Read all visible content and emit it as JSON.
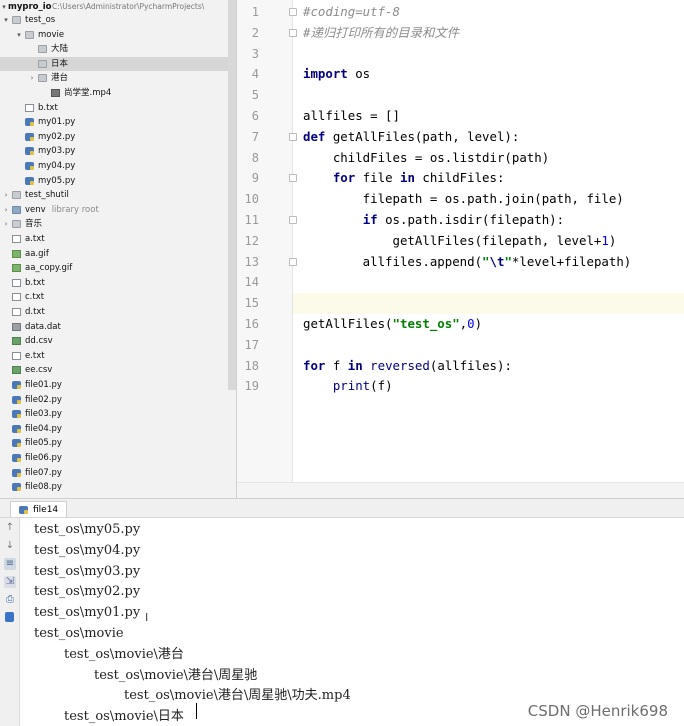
{
  "tree": {
    "root": {
      "label": "mypro_io",
      "path": "C:\\Users\\Administrator\\PycharmProjects\\"
    },
    "items": [
      {
        "label": "test_os",
        "kind": "folder",
        "indent": 0,
        "arrow": "▾"
      },
      {
        "label": "movie",
        "kind": "folder",
        "indent": 1,
        "arrow": "▾"
      },
      {
        "label": "大陆",
        "kind": "folder",
        "indent": 2,
        "arrow": ""
      },
      {
        "label": "日本",
        "kind": "folder",
        "indent": 2,
        "arrow": "",
        "selected": true
      },
      {
        "label": "港台",
        "kind": "folder",
        "indent": 2,
        "arrow": "›"
      },
      {
        "label": "尚学堂.mp4",
        "kind": "mp4",
        "indent": 3,
        "arrow": ""
      },
      {
        "label": "b.txt",
        "kind": "txt",
        "indent": 1,
        "arrow": ""
      },
      {
        "label": "my01.py",
        "kind": "py",
        "indent": 1,
        "arrow": ""
      },
      {
        "label": "my02.py",
        "kind": "py",
        "indent": 1,
        "arrow": ""
      },
      {
        "label": "my03.py",
        "kind": "py",
        "indent": 1,
        "arrow": ""
      },
      {
        "label": "my04.py",
        "kind": "py",
        "indent": 1,
        "arrow": ""
      },
      {
        "label": "my05.py",
        "kind": "py",
        "indent": 1,
        "arrow": ""
      },
      {
        "label": "test_shutil",
        "kind": "folder",
        "indent": 0,
        "arrow": "›"
      },
      {
        "label": "venv",
        "sub": "library root",
        "kind": "folder-src",
        "indent": 0,
        "arrow": "›"
      },
      {
        "label": "音乐",
        "kind": "folder",
        "indent": 0,
        "arrow": "›"
      },
      {
        "label": "a.txt",
        "kind": "txt",
        "indent": 0,
        "arrow": ""
      },
      {
        "label": "aa.gif",
        "kind": "img",
        "indent": 0,
        "arrow": ""
      },
      {
        "label": "aa_copy.gif",
        "kind": "img",
        "indent": 0,
        "arrow": ""
      },
      {
        "label": "b.txt",
        "kind": "txt",
        "indent": 0,
        "arrow": ""
      },
      {
        "label": "c.txt",
        "kind": "txt",
        "indent": 0,
        "arrow": ""
      },
      {
        "label": "d.txt",
        "kind": "txt",
        "indent": 0,
        "arrow": ""
      },
      {
        "label": "data.dat",
        "kind": "dat",
        "indent": 0,
        "arrow": ""
      },
      {
        "label": "dd.csv",
        "kind": "csv",
        "indent": 0,
        "arrow": ""
      },
      {
        "label": "e.txt",
        "kind": "txt",
        "indent": 0,
        "arrow": ""
      },
      {
        "label": "ee.csv",
        "kind": "csv",
        "indent": 0,
        "arrow": ""
      },
      {
        "label": "file01.py",
        "kind": "py",
        "indent": 0,
        "arrow": ""
      },
      {
        "label": "file02.py",
        "kind": "py",
        "indent": 0,
        "arrow": ""
      },
      {
        "label": "file03.py",
        "kind": "py",
        "indent": 0,
        "arrow": ""
      },
      {
        "label": "file04.py",
        "kind": "py",
        "indent": 0,
        "arrow": ""
      },
      {
        "label": "file05.py",
        "kind": "py",
        "indent": 0,
        "arrow": ""
      },
      {
        "label": "file06.py",
        "kind": "py",
        "indent": 0,
        "arrow": ""
      },
      {
        "label": "file07.py",
        "kind": "py",
        "indent": 0,
        "arrow": ""
      },
      {
        "label": "file08.py",
        "kind": "py",
        "indent": 0,
        "arrow": ""
      }
    ]
  },
  "editor": {
    "highlighted_line": 15,
    "lines": [
      {
        "n": "1",
        "fold": true,
        "tokens": [
          {
            "t": "#coding=utf-8",
            "c": "cmt"
          }
        ]
      },
      {
        "n": "2",
        "fold": true,
        "tokens": [
          {
            "t": "#递归打印所有的目录和文件",
            "c": "cmt"
          }
        ]
      },
      {
        "n": "3",
        "tokens": []
      },
      {
        "n": "4",
        "tokens": [
          {
            "t": "import",
            "c": "kw"
          },
          {
            "t": " os",
            "c": ""
          }
        ]
      },
      {
        "n": "5",
        "tokens": []
      },
      {
        "n": "6",
        "tokens": [
          {
            "t": "allfiles = []",
            "c": ""
          }
        ]
      },
      {
        "n": "7",
        "fold": true,
        "tokens": [
          {
            "t": "def",
            "c": "kw"
          },
          {
            "t": " getAllFiles(path, level):",
            "c": ""
          }
        ]
      },
      {
        "n": "8",
        "tokens": [
          {
            "t": "    childFiles = os.listdir(path)",
            "c": ""
          }
        ]
      },
      {
        "n": "9",
        "fold": true,
        "tokens": [
          {
            "t": "    ",
            "c": ""
          },
          {
            "t": "for",
            "c": "kw"
          },
          {
            "t": " file ",
            "c": ""
          },
          {
            "t": "in",
            "c": "kw"
          },
          {
            "t": " childFiles:",
            "c": ""
          }
        ]
      },
      {
        "n": "10",
        "tokens": [
          {
            "t": "        filepath = os.path.join(path, file)",
            "c": ""
          }
        ]
      },
      {
        "n": "11",
        "fold": true,
        "tokens": [
          {
            "t": "        ",
            "c": ""
          },
          {
            "t": "if",
            "c": "kw"
          },
          {
            "t": " os.path.isdir(filepath):",
            "c": ""
          }
        ]
      },
      {
        "n": "12",
        "tokens": [
          {
            "t": "            getAllFiles(filepath, level+",
            "c": ""
          },
          {
            "t": "1",
            "c": "num"
          },
          {
            "t": ")",
            "c": ""
          }
        ]
      },
      {
        "n": "13",
        "fold": true,
        "tokens": [
          {
            "t": "        allfiles.append(",
            "c": ""
          },
          {
            "t": "\"",
            "c": "str"
          },
          {
            "t": "\\t",
            "c": "esc"
          },
          {
            "t": "\"",
            "c": "str"
          },
          {
            "t": "*level+filepath)",
            "c": ""
          }
        ]
      },
      {
        "n": "14",
        "tokens": []
      },
      {
        "n": "15",
        "tokens": []
      },
      {
        "n": "16",
        "tokens": [
          {
            "t": "getAllFiles(",
            "c": ""
          },
          {
            "t": "\"test_os\"",
            "c": "str"
          },
          {
            "t": ",",
            "c": ""
          },
          {
            "t": "0",
            "c": "num"
          },
          {
            "t": ")",
            "c": ""
          }
        ]
      },
      {
        "n": "17",
        "tokens": []
      },
      {
        "n": "18",
        "tokens": [
          {
            "t": "for",
            "c": "kw"
          },
          {
            "t": " f ",
            "c": ""
          },
          {
            "t": "in",
            "c": "kw"
          },
          {
            "t": " ",
            "c": ""
          },
          {
            "t": "reversed",
            "c": "bi"
          },
          {
            "t": "(allfiles):",
            "c": ""
          }
        ]
      },
      {
        "n": "19",
        "tokens": [
          {
            "t": "    ",
            "c": ""
          },
          {
            "t": "print",
            "c": "bi"
          },
          {
            "t": "(f)",
            "c": ""
          }
        ]
      }
    ]
  },
  "run": {
    "tab_label": "file14",
    "output": [
      {
        "text": "test_os\\my05.py",
        "indent": 0
      },
      {
        "text": "test_os\\my04.py",
        "indent": 0
      },
      {
        "text": "test_os\\my03.py",
        "indent": 0
      },
      {
        "text": "test_os\\my02.py",
        "indent": 0
      },
      {
        "text": "test_os\\my01.py",
        "indent": 0
      },
      {
        "text": "test_os\\movie",
        "indent": 0
      },
      {
        "text": "test_os\\movie\\港台",
        "indent": 1
      },
      {
        "text": "test_os\\movie\\港台\\周星驰",
        "indent": 2
      },
      {
        "text": "test_os\\movie\\港台\\周星驰\\功夫.mp4",
        "indent": 3
      },
      {
        "text": "test_os\\movie\\日本",
        "indent": 1
      }
    ],
    "toolbar_icons": [
      "arrow-up-icon",
      "arrow-down-icon",
      "soft-wrap-icon",
      "scroll-to-end-icon",
      "print-icon",
      "trash-icon"
    ]
  },
  "watermark": "CSDN @Henrik698",
  "colors": {
    "keyword": "#000080",
    "string": "#008000",
    "comment": "#8c8c8c",
    "number": "#0000ff",
    "selection": "#d6d6d6"
  }
}
